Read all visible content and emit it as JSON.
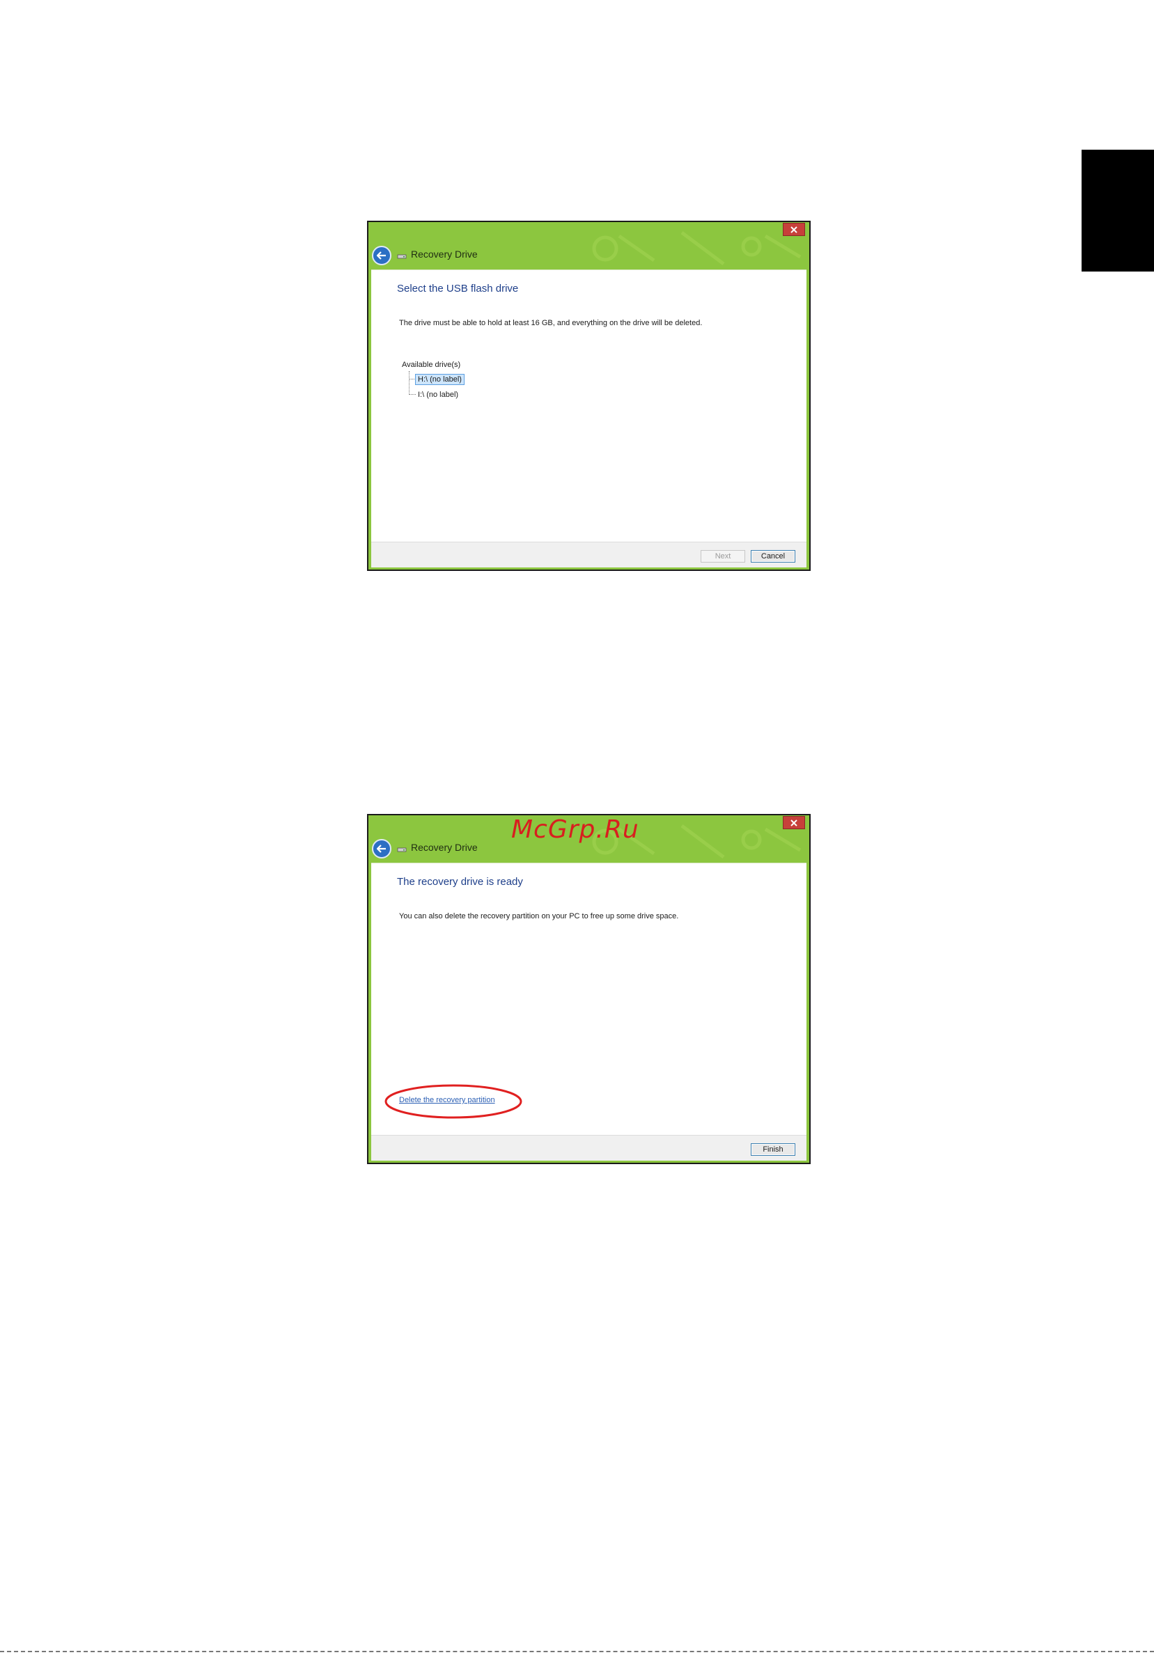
{
  "dialog_select": {
    "window_title": "Recovery Drive",
    "heading": "Select the USB flash drive",
    "description": "The drive must be able to hold at least 16 GB, and everything on the drive will be deleted.",
    "available_drives_label": "Available drive(s)",
    "drives": [
      {
        "label": "H:\\ (no label)",
        "selected": true
      },
      {
        "label": "I:\\ (no label)",
        "selected": false
      }
    ],
    "next_label": "Next",
    "cancel_label": "Cancel"
  },
  "dialog_ready": {
    "window_title": "Recovery Drive",
    "heading": "The recovery drive is ready",
    "description": "You can also delete the recovery partition on your PC to free up some drive space.",
    "delete_link": "Delete the recovery partition",
    "finish_label": "Finish",
    "watermark": "McGrp.Ru"
  },
  "colors": {
    "titlebar_green": "#8cc63f",
    "heading_blue": "#1e3f8a",
    "close_red": "#c7403a",
    "highlight_red": "#e02020"
  },
  "icons": [
    "close-icon",
    "back-arrow-icon",
    "drive-icon"
  ]
}
